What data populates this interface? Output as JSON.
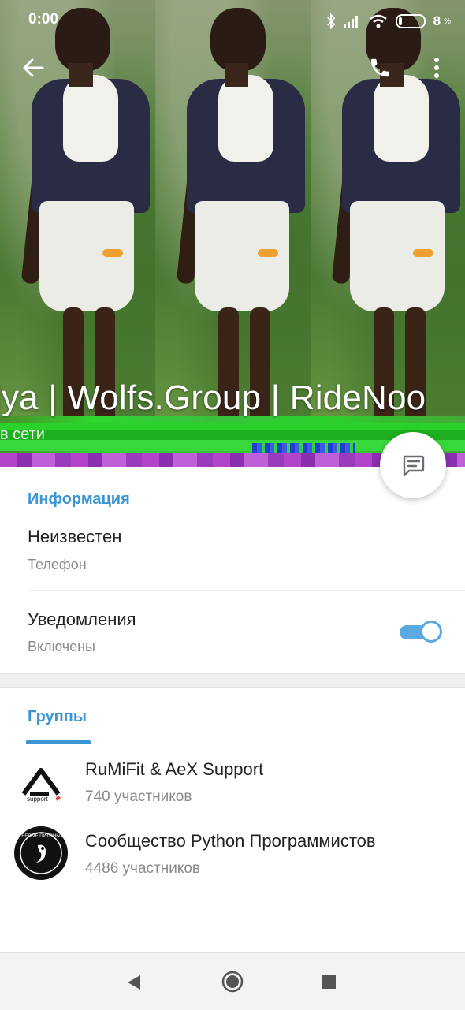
{
  "status_bar": {
    "time": "0:00",
    "battery_percent": "8",
    "percent_sign": "%",
    "icons": [
      "bluetooth-icon",
      "signal-icon",
      "wifi-icon",
      "battery-icon"
    ]
  },
  "header": {
    "profile_name": "lya | Wolfs.Group | RideNoo",
    "status": "в сети",
    "icons": [
      "back-arrow-icon",
      "phone-icon",
      "more-vert-icon"
    ]
  },
  "info": {
    "section_title": "Информация",
    "phone_value": "Неизвестен",
    "phone_label": "Телефон",
    "notifications_title": "Уведомления",
    "notifications_value": "Включены",
    "notifications_enabled": true
  },
  "groups": {
    "tab_label": "Группы",
    "items": [
      {
        "name": "RuMiFit & AeX Support",
        "members": "740 участников",
        "avatar_text": "support"
      },
      {
        "name": "Сообщество Python Программистов",
        "members": "4486 участников",
        "avatar_text": "БЕЛЫЕ ПИТОНЫ"
      }
    ]
  },
  "colors": {
    "accent": "#3a95d5",
    "toggle": "#5aa9e0",
    "secondary_text": "#8a8a8a"
  }
}
